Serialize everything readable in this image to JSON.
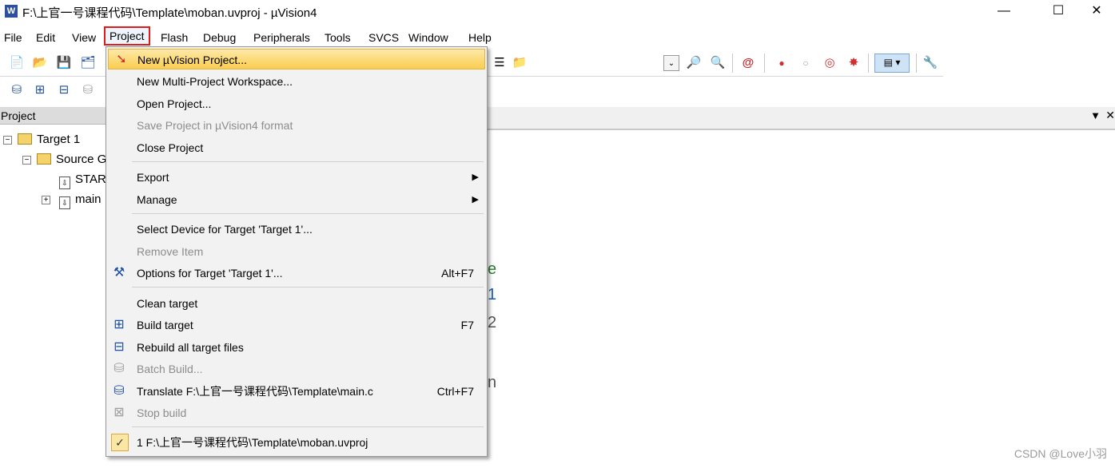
{
  "window": {
    "title": "F:\\上官一号课程代码\\Template\\moban.uvproj - µVision4",
    "app_icon": "W",
    "minimize": "—",
    "maximize": "☐",
    "close": "✕"
  },
  "menubar": [
    "File",
    "Edit",
    "View",
    "Project",
    "Flash",
    "Debug",
    "Peripherals",
    "Tools",
    "SVCS",
    "Window",
    "Help"
  ],
  "project_panel": {
    "header": "Project",
    "tree": {
      "target": "Target 1",
      "group": "Source G",
      "files": [
        "STAR",
        "main"
      ]
    }
  },
  "editor": {
    "dropdown": "▼",
    "close": "✕",
    "fragments": [
      "e",
      "1",
      "2",
      "n"
    ]
  },
  "project_menu": {
    "items": [
      {
        "label": "New µVision Project...",
        "shortcut": "",
        "disabled": false,
        "highlighted": true,
        "icon": "red-arrow-icon"
      },
      {
        "label": "New Multi-Project Workspace...",
        "shortcut": "",
        "disabled": false
      },
      {
        "label": "Open Project...",
        "shortcut": "",
        "disabled": false
      },
      {
        "label": "Save Project in µVision4 format",
        "shortcut": "",
        "disabled": true
      },
      {
        "label": "Close Project",
        "shortcut": "",
        "disabled": false
      },
      {
        "label": "Export",
        "shortcut": "",
        "disabled": false,
        "submenu": true
      },
      {
        "label": "Manage",
        "shortcut": "",
        "disabled": false,
        "submenu": true
      },
      {
        "label": "Select Device for Target 'Target 1'...",
        "shortcut": "",
        "disabled": false
      },
      {
        "label": "Remove Item",
        "shortcut": "",
        "disabled": true
      },
      {
        "label": "Options for Target 'Target 1'...",
        "shortcut": "Alt+F7",
        "disabled": false,
        "icon": "options-wand-icon"
      },
      {
        "label": "Clean target",
        "shortcut": "",
        "disabled": false
      },
      {
        "label": "Build target",
        "shortcut": "F7",
        "disabled": false,
        "icon": "build-icon"
      },
      {
        "label": "Rebuild all target files",
        "shortcut": "",
        "disabled": false,
        "icon": "rebuild-icon"
      },
      {
        "label": "Batch Build...",
        "shortcut": "",
        "disabled": true,
        "icon": "batch-build-icon"
      },
      {
        "label": "Translate F:\\上官一号课程代码\\Template\\main.c",
        "shortcut": "Ctrl+F7",
        "disabled": false,
        "icon": "translate-icon"
      },
      {
        "label": "Stop build",
        "shortcut": "",
        "disabled": true,
        "icon": "stop-build-icon"
      },
      {
        "label": "1 F:\\上官一号课程代码\\Template\\moban.uvproj",
        "shortcut": "",
        "disabled": false,
        "checked": true
      }
    ],
    "submenu_arrow": "▶",
    "check_mark": "✓"
  },
  "watermark": "CSDN @Love小羽"
}
